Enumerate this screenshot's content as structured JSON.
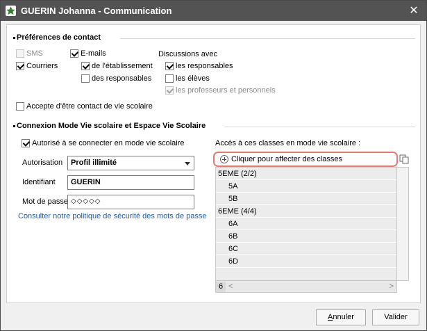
{
  "window": {
    "title": "GUERIN Johanna - Communication"
  },
  "preferences": {
    "section_title": "Préférences de contact",
    "sms_label": "SMS",
    "courriers_label": "Courriers",
    "emails_label": "E-mails",
    "etablissement_label": "de l'établissement",
    "responsables_label": "des responsables",
    "discussions_title": "Discussions avec",
    "disc_responsables_label": "les responsables",
    "disc_eleves_label": "les élèves",
    "disc_profs_label": "les professeurs et personnels",
    "accept_vie_scolaire_label": "Accepte d'être contact de vie scolaire",
    "states": {
      "sms": false,
      "courriers": true,
      "emails": true,
      "etablissement": true,
      "responsables": false,
      "disc_responsables": true,
      "disc_eleves": false,
      "disc_profs": true,
      "accept_vie_scolaire": false
    }
  },
  "connexion": {
    "section_title": "Connexion Mode Vie scolaire et Espace Vie Scolaire",
    "authorized_label": "Autorisé à se connecter en mode vie scolaire",
    "authorized_checked": true,
    "autorisation_label": "Autorisation",
    "autorisation_value": "Profil illimité",
    "identifiant_label": "Identifiant",
    "identifiant_value": "GUERIN",
    "password_label": "Mot de passe",
    "password_value": "◇◇◇◇◇",
    "security_link": "Consulter notre politique de sécurité des mots de passe",
    "classes_title": "Accès à ces classes en mode vie scolaire :",
    "add_classes_label": "Cliquer pour affecter des classes",
    "classes": [
      {
        "label": "5EME (2/2)",
        "level": 0
      },
      {
        "label": "5A",
        "level": 1
      },
      {
        "label": "5B",
        "level": 1
      },
      {
        "label": "6EME (4/4)",
        "level": 0
      },
      {
        "label": "6A",
        "level": 1
      },
      {
        "label": "6B",
        "level": 1
      },
      {
        "label": "6C",
        "level": 1
      },
      {
        "label": "6D",
        "level": 1
      }
    ],
    "classes_count": "6"
  },
  "buttons": {
    "cancel_label": "Annuler",
    "cancel_accesskey": "A",
    "validate_label": "Valider"
  },
  "colors": {
    "title_bar": "#535353",
    "highlight_border": "#e97871",
    "link": "#1e5aa8"
  }
}
